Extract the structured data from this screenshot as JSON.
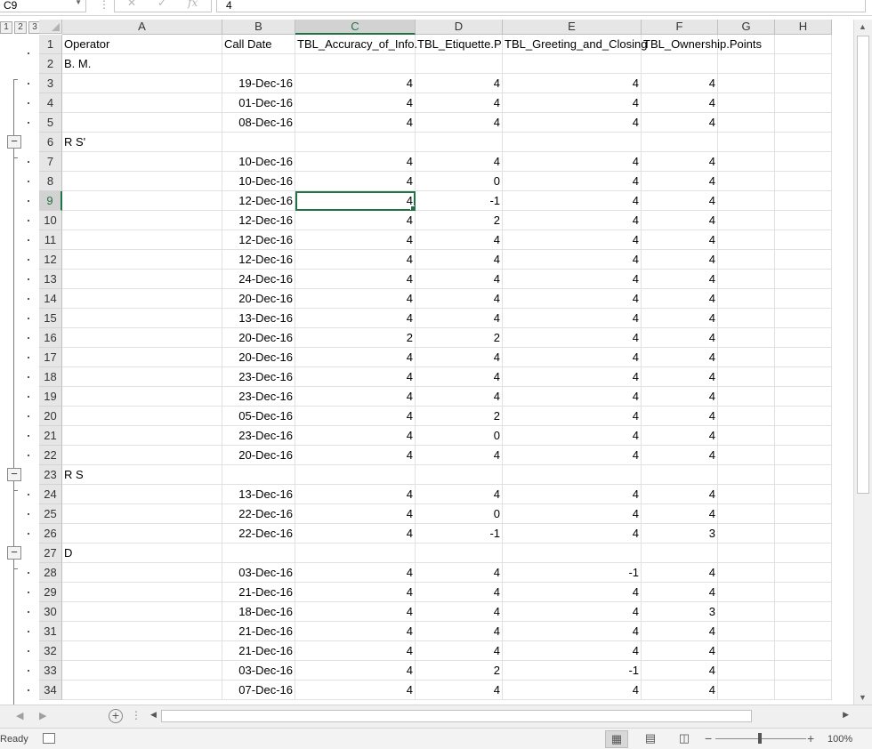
{
  "formula_bar": {
    "name_box": "C9",
    "value": "4",
    "fx_label": "fx",
    "cancel_glyph": "✕",
    "enter_glyph": "✓"
  },
  "outline": {
    "levels": [
      "1",
      "2",
      "3"
    ]
  },
  "columns": [
    "A",
    "B",
    "C",
    "D",
    "E",
    "F",
    "G",
    "H"
  ],
  "active_column": "C",
  "active_row": "9",
  "header_row": {
    "num": "1",
    "A": "Operator",
    "B": "Call Date",
    "C": "TBL_Accuracy_of_Info.",
    "D": "TBL_Etiquette.P",
    "E": "TBL_Greeting_and_Closing",
    "F": "TBL_Ownership.Points"
  },
  "rows": [
    {
      "num": "2",
      "group": true,
      "label": "B.            M."
    },
    {
      "num": "3",
      "date": "19-Dec-16",
      "c": "4",
      "d": "4",
      "e": "4",
      "f": "4"
    },
    {
      "num": "4",
      "date": "01-Dec-16",
      "c": "4",
      "d": "4",
      "e": "4",
      "f": "4"
    },
    {
      "num": "5",
      "date": "08-Dec-16",
      "c": "4",
      "d": "4",
      "e": "4",
      "f": "4"
    },
    {
      "num": "6",
      "group": true,
      "label": "R            S'"
    },
    {
      "num": "7",
      "date": "10-Dec-16",
      "c": "4",
      "d": "4",
      "e": "4",
      "f": "4"
    },
    {
      "num": "8",
      "date": "10-Dec-16",
      "c": "4",
      "d": "0",
      "e": "4",
      "f": "4"
    },
    {
      "num": "9",
      "date": "12-Dec-16",
      "c": "4",
      "d": "-1",
      "e": "4",
      "f": "4"
    },
    {
      "num": "10",
      "date": "12-Dec-16",
      "c": "4",
      "d": "2",
      "e": "4",
      "f": "4"
    },
    {
      "num": "11",
      "date": "12-Dec-16",
      "c": "4",
      "d": "4",
      "e": "4",
      "f": "4"
    },
    {
      "num": "12",
      "date": "12-Dec-16",
      "c": "4",
      "d": "4",
      "e": "4",
      "f": "4"
    },
    {
      "num": "13",
      "date": "24-Dec-16",
      "c": "4",
      "d": "4",
      "e": "4",
      "f": "4"
    },
    {
      "num": "14",
      "date": "20-Dec-16",
      "c": "4",
      "d": "4",
      "e": "4",
      "f": "4"
    },
    {
      "num": "15",
      "date": "13-Dec-16",
      "c": "4",
      "d": "4",
      "e": "4",
      "f": "4"
    },
    {
      "num": "16",
      "date": "20-Dec-16",
      "c": "2",
      "d": "2",
      "e": "4",
      "f": "4"
    },
    {
      "num": "17",
      "date": "20-Dec-16",
      "c": "4",
      "d": "4",
      "e": "4",
      "f": "4"
    },
    {
      "num": "18",
      "date": "23-Dec-16",
      "c": "4",
      "d": "4",
      "e": "4",
      "f": "4"
    },
    {
      "num": "19",
      "date": "23-Dec-16",
      "c": "4",
      "d": "4",
      "e": "4",
      "f": "4"
    },
    {
      "num": "20",
      "date": "05-Dec-16",
      "c": "4",
      "d": "2",
      "e": "4",
      "f": "4"
    },
    {
      "num": "21",
      "date": "23-Dec-16",
      "c": "4",
      "d": "0",
      "e": "4",
      "f": "4"
    },
    {
      "num": "22",
      "date": "20-Dec-16",
      "c": "4",
      "d": "4",
      "e": "4",
      "f": "4"
    },
    {
      "num": "23",
      "group": true,
      "label": "R   S"
    },
    {
      "num": "24",
      "date": "13-Dec-16",
      "c": "4",
      "d": "4",
      "e": "4",
      "f": "4"
    },
    {
      "num": "25",
      "date": "22-Dec-16",
      "c": "4",
      "d": "0",
      "e": "4",
      "f": "4"
    },
    {
      "num": "26",
      "date": "22-Dec-16",
      "c": "4",
      "d": "-1",
      "e": "4",
      "f": "3"
    },
    {
      "num": "27",
      "group": true,
      "label": "D"
    },
    {
      "num": "28",
      "date": "03-Dec-16",
      "c": "4",
      "d": "4",
      "e": "-1",
      "f": "4"
    },
    {
      "num": "29",
      "date": "21-Dec-16",
      "c": "4",
      "d": "4",
      "e": "4",
      "f": "4"
    },
    {
      "num": "30",
      "date": "18-Dec-16",
      "c": "4",
      "d": "4",
      "e": "4",
      "f": "3"
    },
    {
      "num": "31",
      "date": "21-Dec-16",
      "c": "4",
      "d": "4",
      "e": "4",
      "f": "4"
    },
    {
      "num": "32",
      "date": "21-Dec-16",
      "c": "4",
      "d": "4",
      "e": "4",
      "f": "4"
    },
    {
      "num": "33",
      "date": "03-Dec-16",
      "c": "4",
      "d": "2",
      "e": "-1",
      "f": "4"
    },
    {
      "num": "34",
      "date": "07-Dec-16",
      "c": "4",
      "d": "4",
      "e": "4",
      "f": "4"
    }
  ],
  "status": {
    "ready": "Ready",
    "zoom": "100%",
    "zoom_minus": "−",
    "zoom_plus": "+"
  },
  "colors": {
    "accent": "#217346",
    "header_bg": "#e6e6e6",
    "gridline": "#e1e1e1"
  },
  "icons": {
    "add_sheet": "plus-circle-icon",
    "normal_view": "grid-view-icon",
    "page_layout": "page-layout-icon",
    "page_break": "page-break-icon"
  }
}
